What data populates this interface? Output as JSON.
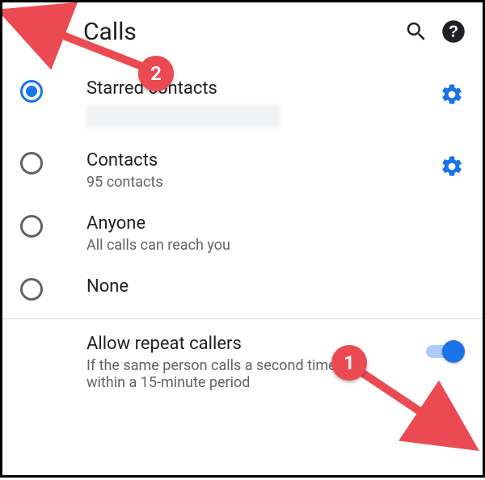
{
  "header": {
    "title": "Calls"
  },
  "options": [
    {
      "title": "Starred contacts",
      "sub": "",
      "selected": true,
      "has_gear": true,
      "redacted_sub": true
    },
    {
      "title": "Contacts",
      "sub": "95 contacts",
      "selected": false,
      "has_gear": true,
      "redacted_sub": false
    },
    {
      "title": "Anyone",
      "sub": "All calls can reach you",
      "selected": false,
      "has_gear": false,
      "redacted_sub": false
    },
    {
      "title": "None",
      "sub": "",
      "selected": false,
      "has_gear": false,
      "redacted_sub": false
    }
  ],
  "repeat": {
    "title": "Allow repeat callers",
    "sub": "If the same person calls a second time within a 15-minute period",
    "on": true
  },
  "annotations": {
    "badge1": "1",
    "badge2": "2"
  },
  "colors": {
    "accent": "#1a73e8",
    "annotation": "#eb4a52"
  }
}
